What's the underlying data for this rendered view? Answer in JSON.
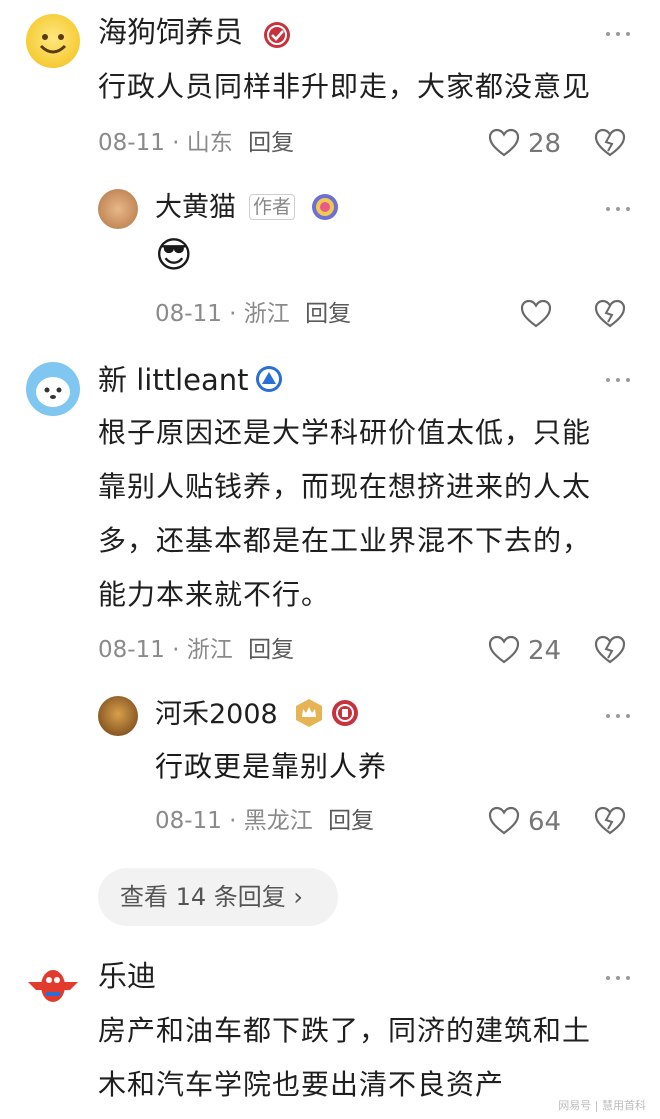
{
  "comments": [
    {
      "user": "海狗饲养员",
      "text": [
        "行政人员同样非升即走，大家都没意见"
      ],
      "date": "08-11",
      "location": "山东",
      "reply_label": "回复",
      "likes": "28",
      "replies": [
        {
          "user": "大黄猫",
          "author_tag": "作者",
          "text": "😎",
          "date": "08-11",
          "location": "浙江",
          "reply_label": "回复",
          "likes": ""
        }
      ]
    },
    {
      "user": "新 littleant",
      "text": [
        "根子原因还是大学科研价值太低，只能",
        "靠别人贴钱养，而现在想挤进来的人太",
        "多，还基本都是在工业界混不下去的，",
        "能力本来就不行。"
      ],
      "date": "08-11",
      "location": "浙江",
      "reply_label": "回复",
      "likes": "24",
      "replies": [
        {
          "user": "河禾2008",
          "text": "行政更是靠别人养",
          "date": "08-11",
          "location": "黑龙江",
          "reply_label": "回复",
          "likes": "64"
        }
      ],
      "more_replies": "查看 14 条回复 ›"
    },
    {
      "user": "乐迪",
      "text": [
        "房产和油车都下跌了，同济的建筑和土",
        "木和汽车学院也要出清不良资产"
      ]
    }
  ],
  "watermark": "网易号 | 慧用首科",
  "colors": {
    "accent_red": "#c8323c",
    "meta_gray": "#8a8a8a",
    "pill_bg": "#f2f2f2"
  }
}
